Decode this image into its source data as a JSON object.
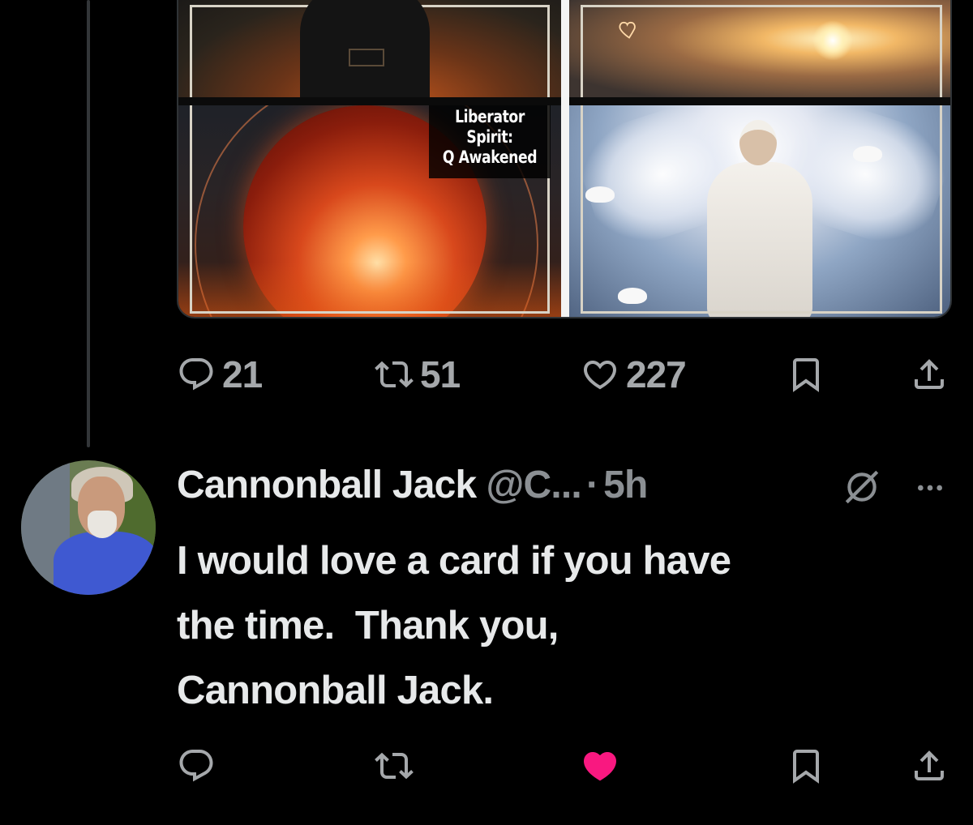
{
  "media": {
    "caption_lines": [
      "Liberator",
      "Spirit:",
      "Q Awakened"
    ]
  },
  "tweet_actions": {
    "replies": "21",
    "reposts": "51",
    "likes": "227"
  },
  "reply": {
    "name": "Cannonball Jack",
    "handle": "@C...",
    "separator": "·",
    "time": "5h",
    "text": "I would love a card if you have\nthe time.  Thank you,\nCannonball Jack."
  },
  "colors": {
    "background": "#000000",
    "text_primary": "#e7e9ea",
    "text_secondary": "#8b8f93",
    "icon_gray": "#a5a8ab",
    "like_pink": "#f91880",
    "thread_line": "#333639"
  },
  "icons": {
    "reply": "reply-icon",
    "repost": "repost-icon",
    "like": "heart-icon",
    "bookmark": "bookmark-icon",
    "share": "share-icon",
    "grok": "grok-icon",
    "more": "more-icon"
  },
  "reply_actions": {
    "liked": true
  }
}
